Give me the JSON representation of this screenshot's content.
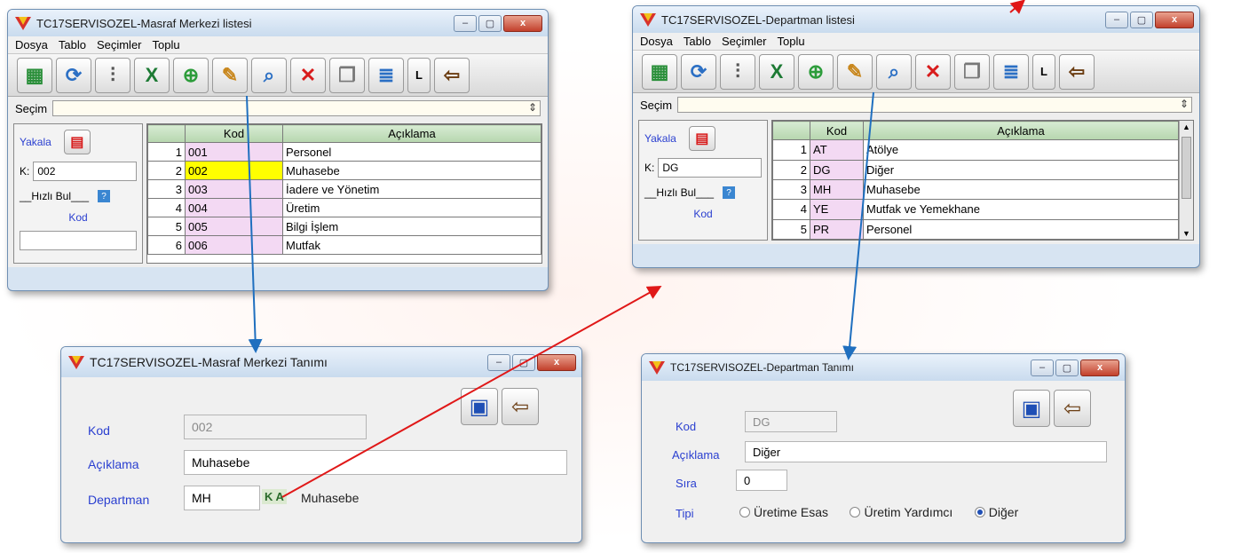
{
  "masraf_list": {
    "title": "TC17SERVISOZEL-Masraf Merkezi listesi",
    "menu": [
      "Dosya",
      "Tablo",
      "Seçimler",
      "Toplu"
    ],
    "secim_label": "Seçim",
    "yakala_label": "Yakala",
    "k_label": "K:",
    "k_value": "002",
    "hizli_bul": "__Hızlı Bul___",
    "kod_label": "Kod",
    "columns": [
      "Kod",
      "Açıklama"
    ],
    "rows": [
      {
        "no": "1",
        "kod": "001",
        "aciklama": "Personel"
      },
      {
        "no": "2",
        "kod": "002",
        "aciklama": "Muhasebe"
      },
      {
        "no": "3",
        "kod": "003",
        "aciklama": "İadere ve Yönetim"
      },
      {
        "no": "4",
        "kod": "004",
        "aciklama": "Üretim"
      },
      {
        "no": "5",
        "kod": "005",
        "aciklama": "Bilgi İşlem"
      },
      {
        "no": "6",
        "kod": "006",
        "aciklama": "Mutfak"
      }
    ]
  },
  "departman_list": {
    "title": "TC17SERVISOZEL-Departman listesi",
    "menu": [
      "Dosya",
      "Tablo",
      "Seçimler",
      "Toplu"
    ],
    "secim_label": "Seçim",
    "yakala_label": "Yakala",
    "k_label": "K:",
    "k_value": "DG",
    "hizli_bul": "__Hızlı Bul___",
    "kod_label": "Kod",
    "columns": [
      "Kod",
      "Açıklama"
    ],
    "rows": [
      {
        "no": "1",
        "kod": "AT",
        "aciklama": "Atölye"
      },
      {
        "no": "2",
        "kod": "DG",
        "aciklama": "Diğer"
      },
      {
        "no": "3",
        "kod": "MH",
        "aciklama": "Muhasebe"
      },
      {
        "no": "4",
        "kod": "YE",
        "aciklama": "Mutfak ve Yemekhane"
      },
      {
        "no": "5",
        "kod": "PR",
        "aciklama": "Personel"
      }
    ]
  },
  "masraf_form": {
    "title": "TC17SERVISOZEL-Masraf Merkezi Tanımı",
    "kod_label": "Kod",
    "kod_value": "002",
    "aciklama_label": "Açıklama",
    "aciklama_value": "Muhasebe",
    "departman_label": "Departman",
    "departman_value": "MH",
    "ka_label": "K A",
    "departman_name": "Muhasebe"
  },
  "departman_form": {
    "title": "TC17SERVISOZEL-Departman Tanımı",
    "kod_label": "Kod",
    "kod_value": "DG",
    "aciklama_label": "Açıklama",
    "aciklama_value": "Diğer",
    "sira_label": "Sıra",
    "sira_value": "0",
    "tipi_label": "Tipi",
    "options": [
      "Üretime Esas",
      "Üretim Yardımcı",
      "Diğer"
    ],
    "selected": "Diğer"
  },
  "colors": {
    "accent_blue": "#1f6fbf",
    "arrow_red": "#e01818",
    "selected_row": "#ffff00",
    "kod_cell": "#f3d9f3"
  }
}
